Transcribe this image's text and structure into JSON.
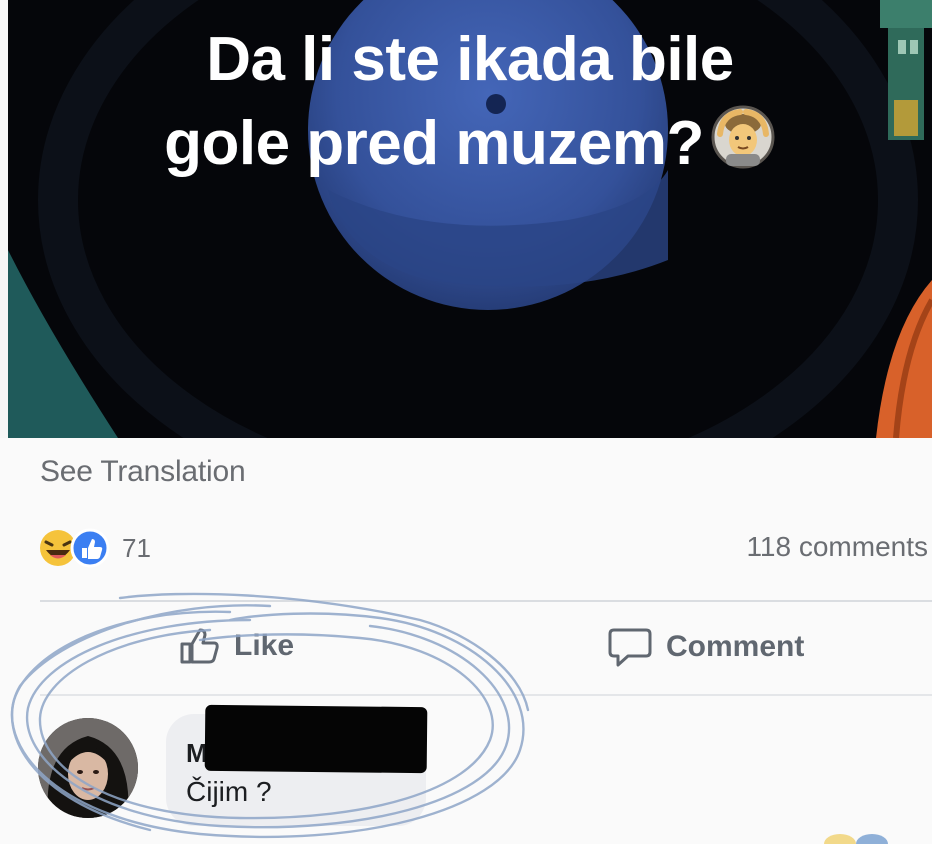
{
  "post": {
    "headline_line1": "Da li ste ikada bile",
    "headline_line2": "gole pred muzem?",
    "headline_emoji": "person-gesturing-ok-emoji"
  },
  "translation": {
    "label": "See Translation"
  },
  "stats": {
    "reaction_icons": [
      "haha-emoji-icon",
      "like-reaction-icon"
    ],
    "reaction_count": "71",
    "comments_count": "118 comments"
  },
  "actions": {
    "like_label": "Like",
    "like_icon": "thumbs-up-icon",
    "comment_label": "Comment",
    "comment_icon": "speech-bubble-icon"
  },
  "comment": {
    "author_visible": "M",
    "text": "Čijim ?"
  },
  "colors": {
    "image_background": "#05060a",
    "planet_blue": "#3a5aa8",
    "muted_text": "#6a6d72",
    "action_text": "#606770",
    "scribble_pen": "#8fa6c8"
  }
}
